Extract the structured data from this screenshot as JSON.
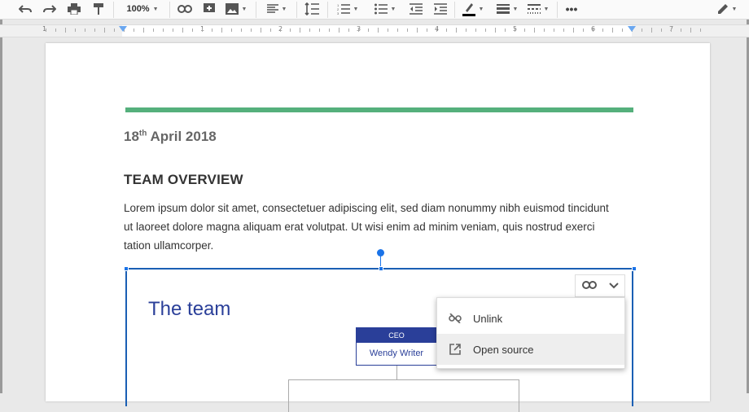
{
  "toolbar": {
    "zoom": "100%",
    "buttons": [
      "undo-icon",
      "redo-icon",
      "print-icon",
      "paint-format-icon",
      "link-icon",
      "insert-comment-icon",
      "insert-image-icon",
      "align-icon",
      "line-spacing-icon",
      "numbered-list-icon",
      "bulleted-list-icon",
      "decrease-indent-icon",
      "increase-indent-icon",
      "highlight-icon",
      "border-weight-icon",
      "border-dash-icon",
      "more-icon",
      "edit-mode-icon"
    ]
  },
  "ruler": {
    "numbers": [
      "1",
      "1",
      "2",
      "3",
      "4",
      "5",
      "6",
      "7"
    ]
  },
  "document": {
    "date_day": "18",
    "date_suffix": "th",
    "date_rest": " April 2018",
    "heading": "TEAM OVERVIEW",
    "body": "Lorem ipsum dolor sit amet, consectetuer adipiscing elit, sed diam nonummy nibh euismod tincidunt ut laoreet dolore magna aliquam erat volutpat. Ut wisi enim ad minim veniam, quis nostrud exerci tation ullamcorper."
  },
  "embed": {
    "title": "The team",
    "ceo_label": "CEO",
    "ceo_name": "Wendy Writer"
  },
  "menu": {
    "items": [
      {
        "label": "Unlink",
        "icon": "unlink-icon"
      },
      {
        "label": "Open source",
        "icon": "open-in-new-icon"
      }
    ]
  },
  "colors": {
    "accent_green": "#55b07c",
    "selection_blue": "#1a73e8",
    "slide_blue": "#2a3f99"
  }
}
